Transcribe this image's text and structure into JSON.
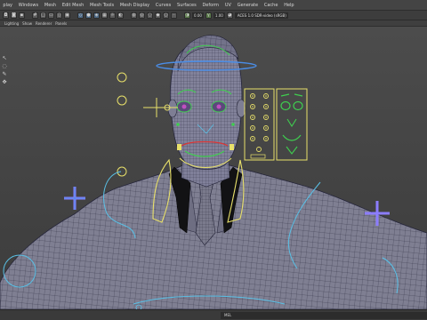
{
  "menubar": {
    "items": [
      "play",
      "Windows",
      "Mesh",
      "Edit Mesh",
      "Mesh Tools",
      "Mesh Display",
      "Curves",
      "Surfaces",
      "Deform",
      "UV",
      "Generate",
      "Cache",
      "Help"
    ]
  },
  "toolbar": {
    "mode_field": "ACES 1.0 SDR-video (sRGB)",
    "value_a": "0.00",
    "value_b": "1.00"
  },
  "panel_menu": {
    "items": [
      "Lighting",
      "Show",
      "Renderer",
      "Panels"
    ]
  },
  "status_bar": {
    "command_label": "MEL"
  },
  "colors": {
    "mesh_fill": "#7e7e90",
    "wire": "#1e1e30",
    "ctrl_yellow": "#e8e06a",
    "ctrl_green": "#3fce4f",
    "ctrl_blue": "#4a8ee8",
    "ctrl_cyan": "#59c0e6",
    "ctrl_purple": "#8c7dff",
    "ctrl_red": "#d93535"
  }
}
